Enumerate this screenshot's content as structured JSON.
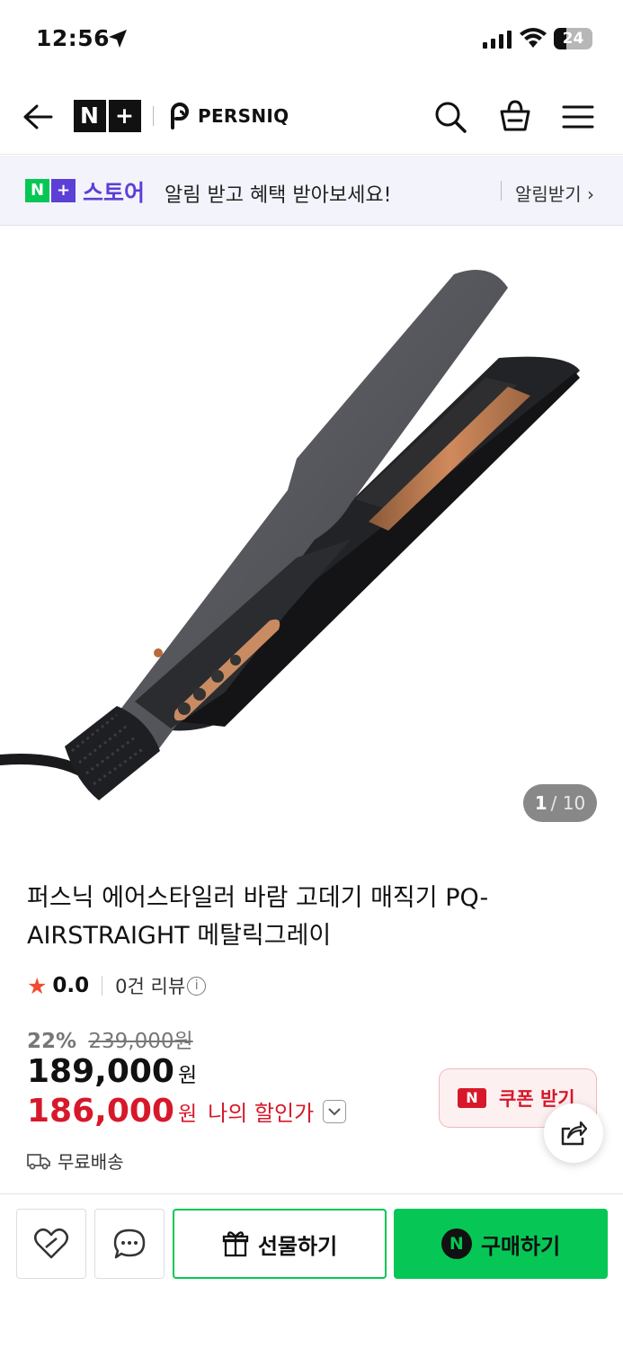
{
  "status_bar": {
    "time": "12:56",
    "battery": "24"
  },
  "header": {
    "logo_n": "N",
    "logo_plus": "+",
    "brand": "PERSNIQ"
  },
  "banner": {
    "badge_n": "N",
    "badge_plus": "+",
    "store": "스토어",
    "message": "알림 받고 혜택 받아보세요!",
    "cta": "알림받기 ›"
  },
  "gallery": {
    "current": "1",
    "separator": "/",
    "total": "10"
  },
  "product": {
    "title": "퍼스닉 에어스타일러 바람 고데기 매직기 PQ-AIRSTRAIGHT 메탈릭그레이",
    "rating": "0.0",
    "reviews": "0건 리뷰",
    "discount_pct": "22%",
    "original_price": "239,000원",
    "price": "189,000",
    "price_unit": "원",
    "my_price": "186,000",
    "my_price_unit": "원",
    "my_price_label": "나의 할인가",
    "shipping": "무료배송"
  },
  "coupon": {
    "badge": "N",
    "label": "쿠폰 받기"
  },
  "actions": {
    "gift": "선물하기",
    "buy_badge": "N",
    "buy": "구매하기"
  },
  "colors": {
    "naver_green": "#06c755",
    "plus_purple": "#5b3fd6",
    "sale_red": "#d7182a"
  }
}
